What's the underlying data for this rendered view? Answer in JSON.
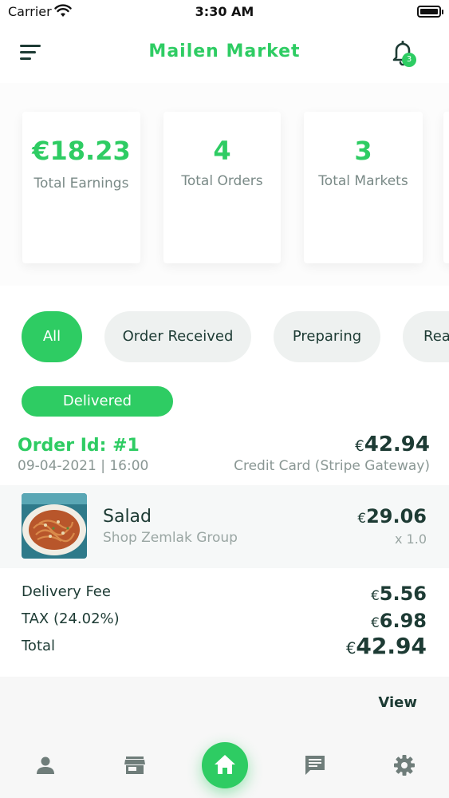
{
  "status_bar": {
    "carrier": "Carrier",
    "time": "3:30 AM"
  },
  "header": {
    "title": "Mailen Market",
    "notification_count": "3"
  },
  "stats": [
    {
      "value": "€18.23",
      "label": "Total Earnings"
    },
    {
      "value": "4",
      "label": "Total Orders"
    },
    {
      "value": "3",
      "label": "Total Markets"
    }
  ],
  "filters": {
    "chips": [
      "All",
      "Order Received",
      "Preparing",
      "Ready"
    ],
    "active": "All",
    "delivered": "Delivered"
  },
  "order": {
    "id_label": "Order Id: #1",
    "date": "09-04-2021 | 16:00",
    "total_currency": "€",
    "total_amount": "42.94",
    "payment": "Credit Card (Stripe Gateway)",
    "item": {
      "name": "Salad",
      "shop": "Shop Zemlak Group",
      "price_currency": "€",
      "price_amount": "29.06",
      "quantity": "x 1.0"
    },
    "fees": [
      {
        "label": "Delivery Fee",
        "currency": "€",
        "amount": "5.56"
      },
      {
        "label": "TAX (24.02%)",
        "currency": "€",
        "amount": "6.98"
      },
      {
        "label": "Total",
        "currency": "€",
        "amount": "42.94"
      }
    ],
    "view_label": "View"
  },
  "bottom_nav": [
    "person-icon",
    "store-icon",
    "home-icon",
    "chat-icon",
    "settings-icon"
  ],
  "colors": {
    "accent": "#2ecc63",
    "text_dark": "#1d3b34",
    "muted": "#8a9794"
  }
}
